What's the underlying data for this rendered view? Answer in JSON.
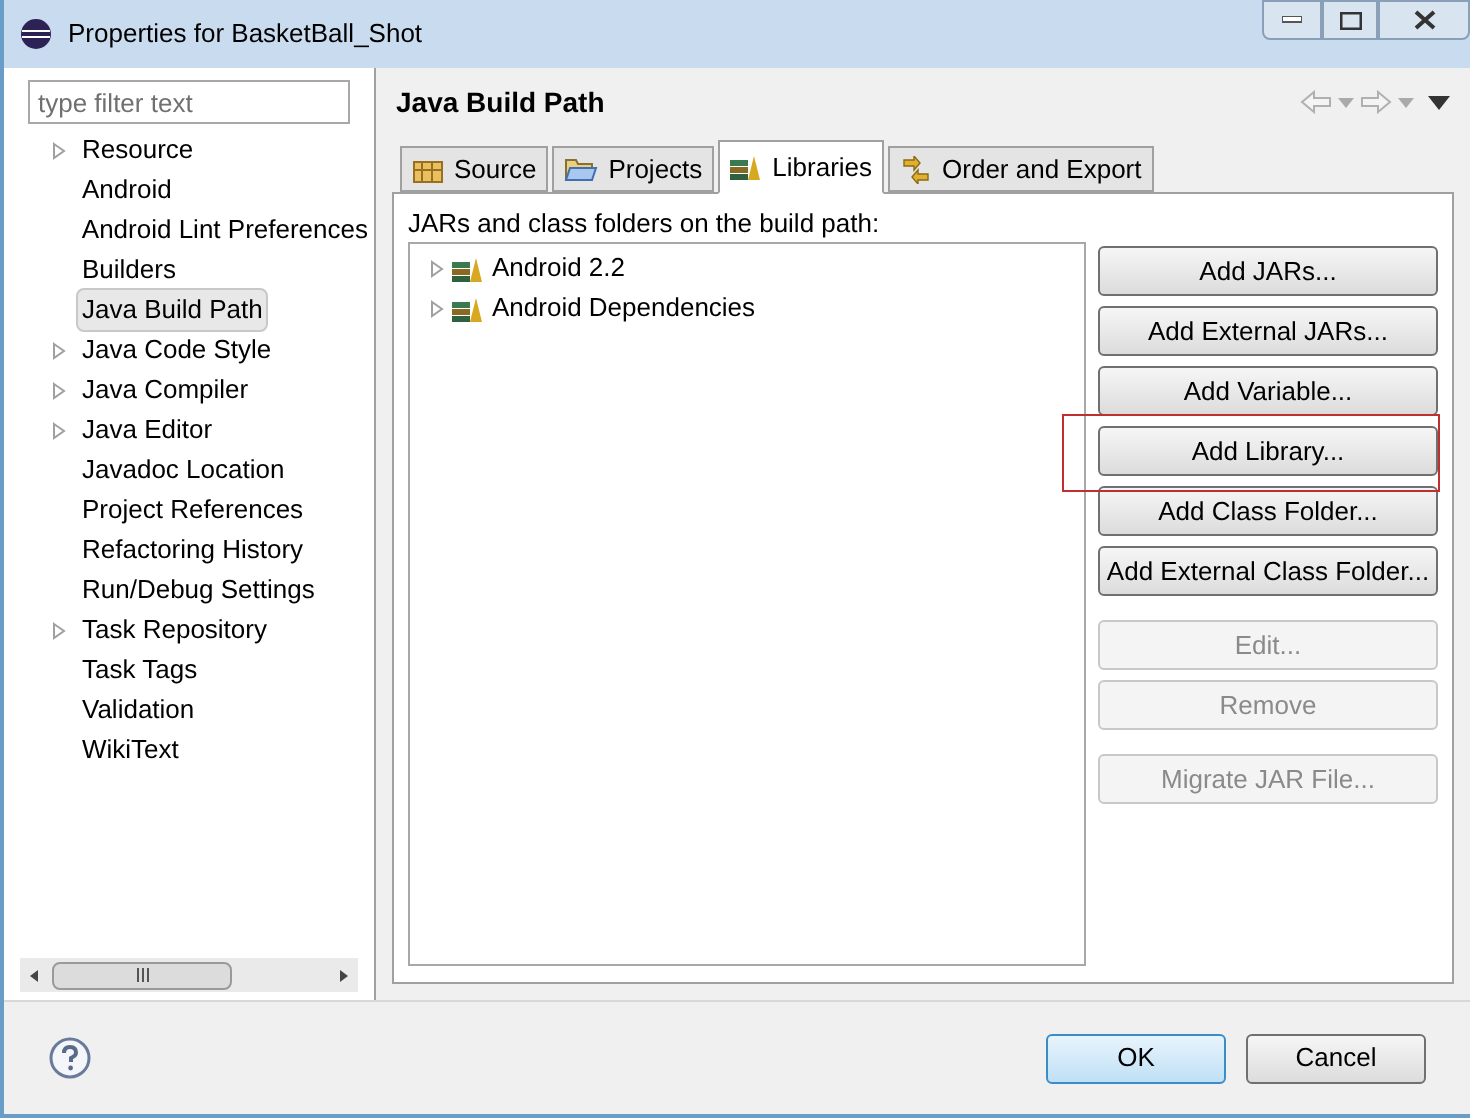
{
  "window": {
    "title": "Properties for BasketBall_Shot"
  },
  "sidebar": {
    "filter": {
      "placeholder": "type filter text"
    },
    "items": [
      {
        "label": "Resource",
        "expandable": true,
        "selected": false
      },
      {
        "label": "Android",
        "expandable": false,
        "selected": false
      },
      {
        "label": "Android Lint Preferences",
        "expandable": false,
        "selected": false
      },
      {
        "label": "Builders",
        "expandable": false,
        "selected": false
      },
      {
        "label": "Java Build Path",
        "expandable": false,
        "selected": true
      },
      {
        "label": "Java Code Style",
        "expandable": true,
        "selected": false
      },
      {
        "label": "Java Compiler",
        "expandable": true,
        "selected": false
      },
      {
        "label": "Java Editor",
        "expandable": true,
        "selected": false
      },
      {
        "label": "Javadoc Location",
        "expandable": false,
        "selected": false
      },
      {
        "label": "Project References",
        "expandable": false,
        "selected": false
      },
      {
        "label": "Refactoring History",
        "expandable": false,
        "selected": false
      },
      {
        "label": "Run/Debug Settings",
        "expandable": false,
        "selected": false
      },
      {
        "label": "Task Repository",
        "expandable": true,
        "selected": false
      },
      {
        "label": "Task Tags",
        "expandable": false,
        "selected": false
      },
      {
        "label": "Validation",
        "expandable": false,
        "selected": false
      },
      {
        "label": "WikiText",
        "expandable": false,
        "selected": false
      }
    ]
  },
  "page": {
    "title": "Java Build Path",
    "tabs": [
      {
        "label": "Source",
        "kind": "source",
        "selected": false
      },
      {
        "label": "Projects",
        "kind": "projects",
        "selected": false
      },
      {
        "label": "Libraries",
        "kind": "libraries",
        "selected": true
      },
      {
        "label": "Order and Export",
        "kind": "order",
        "selected": false
      }
    ],
    "caption": "JARs and class folders on the build path:",
    "libraries": [
      {
        "label": "Android 2.2"
      },
      {
        "label": "Android Dependencies"
      }
    ],
    "button_groups": [
      [
        {
          "label": "Add JARs...",
          "disabled": false,
          "highlighted": false
        },
        {
          "label": "Add External JARs...",
          "disabled": false,
          "highlighted": false
        },
        {
          "label": "Add Variable...",
          "disabled": false,
          "highlighted": false
        },
        {
          "label": "Add Library...",
          "disabled": false,
          "highlighted": true
        },
        {
          "label": "Add Class Folder...",
          "disabled": false,
          "highlighted": false
        },
        {
          "label": "Add External Class Folder...",
          "disabled": false,
          "highlighted": false
        }
      ],
      [
        {
          "label": "Edit...",
          "disabled": true,
          "highlighted": false
        },
        {
          "label": "Remove",
          "disabled": true,
          "highlighted": false
        }
      ],
      [
        {
          "label": "Migrate JAR File...",
          "disabled": true,
          "highlighted": false
        }
      ]
    ]
  },
  "footer": {
    "ok": "OK",
    "cancel": "Cancel"
  }
}
